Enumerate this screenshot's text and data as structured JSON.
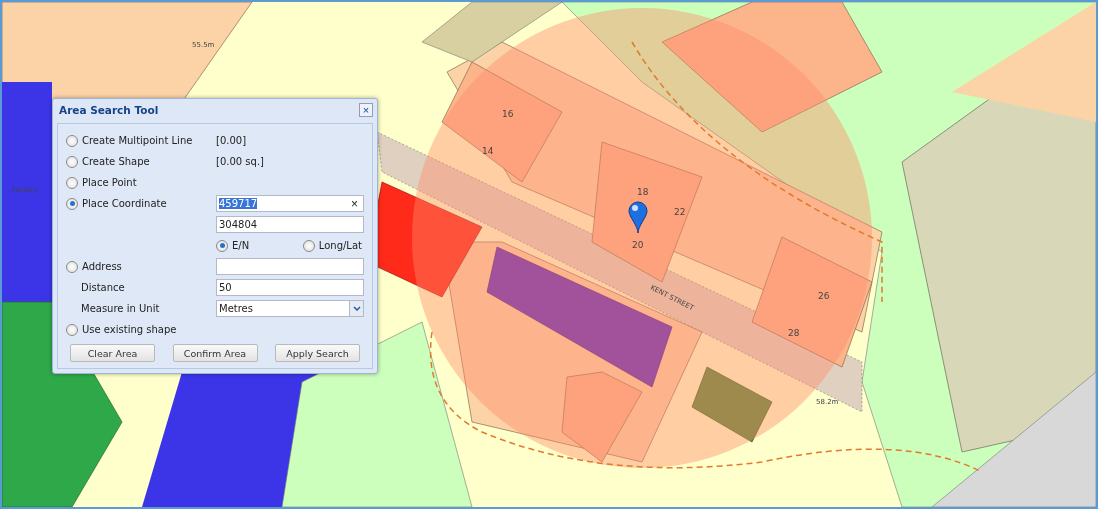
{
  "map": {
    "labels": [
      "55.5m",
      "Factory",
      "KENT STREET",
      "58.2m",
      "16",
      "14",
      "18",
      "22",
      "20",
      "26",
      "28"
    ]
  },
  "dialog": {
    "title": "Area Search Tool",
    "close": "×",
    "rows": [
      {
        "kind": "mode",
        "label": "Create Multipoint Line",
        "selected": false,
        "reading": "[0.00]"
      },
      {
        "kind": "mode",
        "label": "Create Shape",
        "selected": false,
        "reading": "[0.00 sq.]"
      },
      {
        "kind": "mode",
        "label": "Place Point",
        "selected": false
      },
      {
        "kind": "coordinate",
        "label": "Place Coordinate",
        "selected": true,
        "easting": "459717",
        "northing": "304804",
        "clear": "×",
        "systems": [
          {
            "label": "E/N",
            "selected": true
          },
          {
            "label": "Long/Lat",
            "selected": false
          }
        ]
      },
      {
        "kind": "mode_field",
        "label": "Address",
        "selected": false,
        "value": ""
      },
      {
        "kind": "field",
        "label": "Distance",
        "value": "50"
      },
      {
        "kind": "select",
        "label": "Measure in Unit",
        "value": "Metres"
      },
      {
        "kind": "mode",
        "label": "Use existing shape",
        "selected": false
      }
    ],
    "buttons": [
      "Clear Area",
      "Confirm Area",
      "Apply Search"
    ]
  }
}
